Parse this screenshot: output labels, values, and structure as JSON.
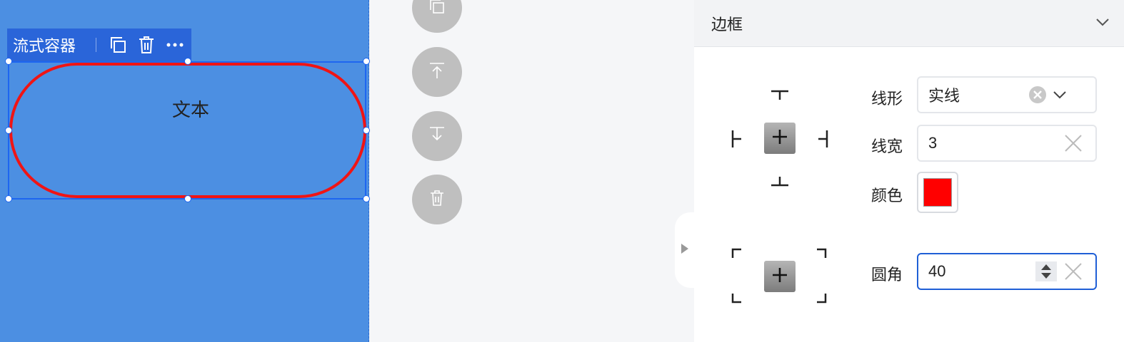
{
  "canvas": {
    "component_label": "流式容器",
    "text_content": "文本",
    "border_color": "#f01414",
    "background": "#4c8fe2"
  },
  "toolbar": {
    "actions": [
      "copy-icon",
      "trash-icon",
      "more-icon"
    ]
  },
  "float_actions": [
    "copy-icon",
    "move-up-icon",
    "move-down-icon",
    "trash-icon"
  ],
  "panel": {
    "title": "边框",
    "line_style": {
      "label": "线形",
      "value": "实线"
    },
    "line_width": {
      "label": "线宽",
      "value": "3"
    },
    "color": {
      "label": "颜色",
      "value": "#ff0000"
    },
    "radius": {
      "label": "圆角",
      "value": "40"
    }
  },
  "colors": {
    "accent": "#1f5fd6",
    "selection": "#1e66f0",
    "toolbar_bg": "#2a65d9"
  }
}
